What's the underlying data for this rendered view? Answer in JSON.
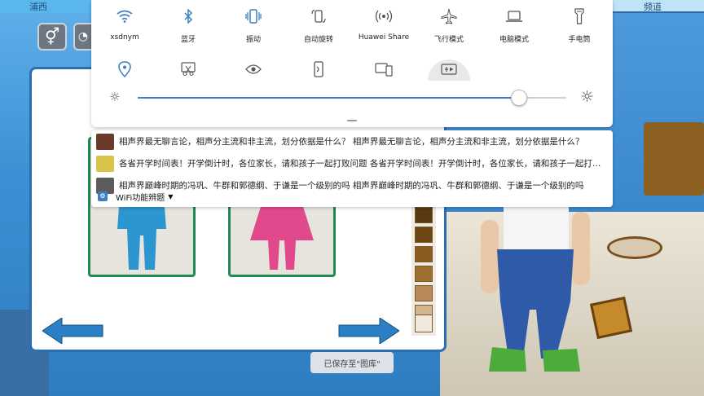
{
  "game": {
    "topbar_left": "浦西",
    "topbar_right": "频道",
    "palette_colors": [
      "#5a3810",
      "#6e4715",
      "#8a5c20",
      "#9e6f30",
      "#b8895a",
      "#d4b48c",
      "#f1e9dc"
    ],
    "colors": {
      "board_border": "#2a6fb0",
      "card_border": "#1e8a52",
      "male_figure": "#2c96d1",
      "female_figure": "#e04a8c",
      "arrow": "#2a7fc6"
    }
  },
  "toast": {
    "text": "已保存至\"图库\""
  },
  "quick_settings": {
    "row1": [
      {
        "label": "xsdnym",
        "icon": "wifi-icon",
        "active": true
      },
      {
        "label": "蓝牙",
        "icon": "bluetooth-icon",
        "active": true
      },
      {
        "label": "振动",
        "icon": "vibrate-icon",
        "active": true
      },
      {
        "label": "自动旋转",
        "icon": "auto-rotate-icon",
        "active": false
      },
      {
        "label": "Huawei Share",
        "icon": "huawei-share-icon",
        "active": false
      },
      {
        "label": "飞行模式",
        "icon": "airplane-icon",
        "active": false
      },
      {
        "label": "电脑模式",
        "icon": "laptop-icon",
        "active": false
      },
      {
        "label": "手电筒",
        "icon": "flashlight-icon",
        "active": false
      }
    ],
    "row2": [
      {
        "icon": "location-icon",
        "active": true
      },
      {
        "icon": "screenshot-icon",
        "active": false
      },
      {
        "icon": "eye-comfort-icon",
        "active": false
      },
      {
        "icon": "nfc-icon",
        "active": false
      },
      {
        "icon": "multi-screen-icon",
        "active": false
      },
      {
        "icon": "screen-record-icon",
        "active": false,
        "highlighted": true
      }
    ],
    "brightness": 0.89,
    "accent": "#3d7fc4"
  },
  "notifications": [
    {
      "text": "相声界最无聊言论，相声分主流和非主流，划分依据是什么？  相声界最无聊言论，相声分主流和非主流，划分依据是什么？",
      "thumb": "#6a3b2a"
    },
    {
      "text": "各省开学时间表！开学倒计时，各位家长，请和孩子一起打败问题  各省开学时间表！开学倒计时，各位家长，请和孩子一起打败问题",
      "thumb": "#d8c44a"
    },
    {
      "text": "相声界巅峰时期的冯巩、牛群和郭德纲、于谦是一个级别的吗  相声界巅峰时期的冯巩、牛群和郭德纲、于谦是一个级别的吗",
      "thumb": "#5c5c5c"
    }
  ],
  "wifi_peek": {
    "text": "WiFi功能辨题"
  }
}
